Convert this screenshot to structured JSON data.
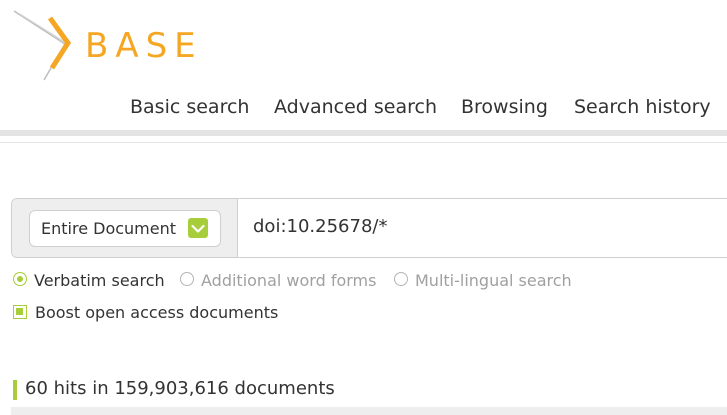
{
  "logo": {
    "text": "BASE"
  },
  "nav": {
    "items": [
      {
        "label": "Basic search"
      },
      {
        "label": "Advanced search"
      },
      {
        "label": "Browsing"
      },
      {
        "label": "Search history"
      }
    ]
  },
  "search": {
    "scope": {
      "selected": "Entire Document",
      "icon": "chevron-down-icon"
    },
    "query": "doi:10.25678/*"
  },
  "options": {
    "verbatim": {
      "label": "Verbatim search",
      "checked": true
    },
    "word_forms": {
      "label": "Additional word forms",
      "checked": false
    },
    "multilingual": {
      "label": "Multi-lingual search",
      "checked": false
    },
    "boost": {
      "label": "Boost open access documents",
      "checked": true
    }
  },
  "results": {
    "summary": "60 hits in 159,903,616 documents"
  },
  "colors": {
    "accent": "#a8cd3a",
    "logo": "#f5a623",
    "text": "#333333",
    "muted": "#a0a0a0"
  }
}
